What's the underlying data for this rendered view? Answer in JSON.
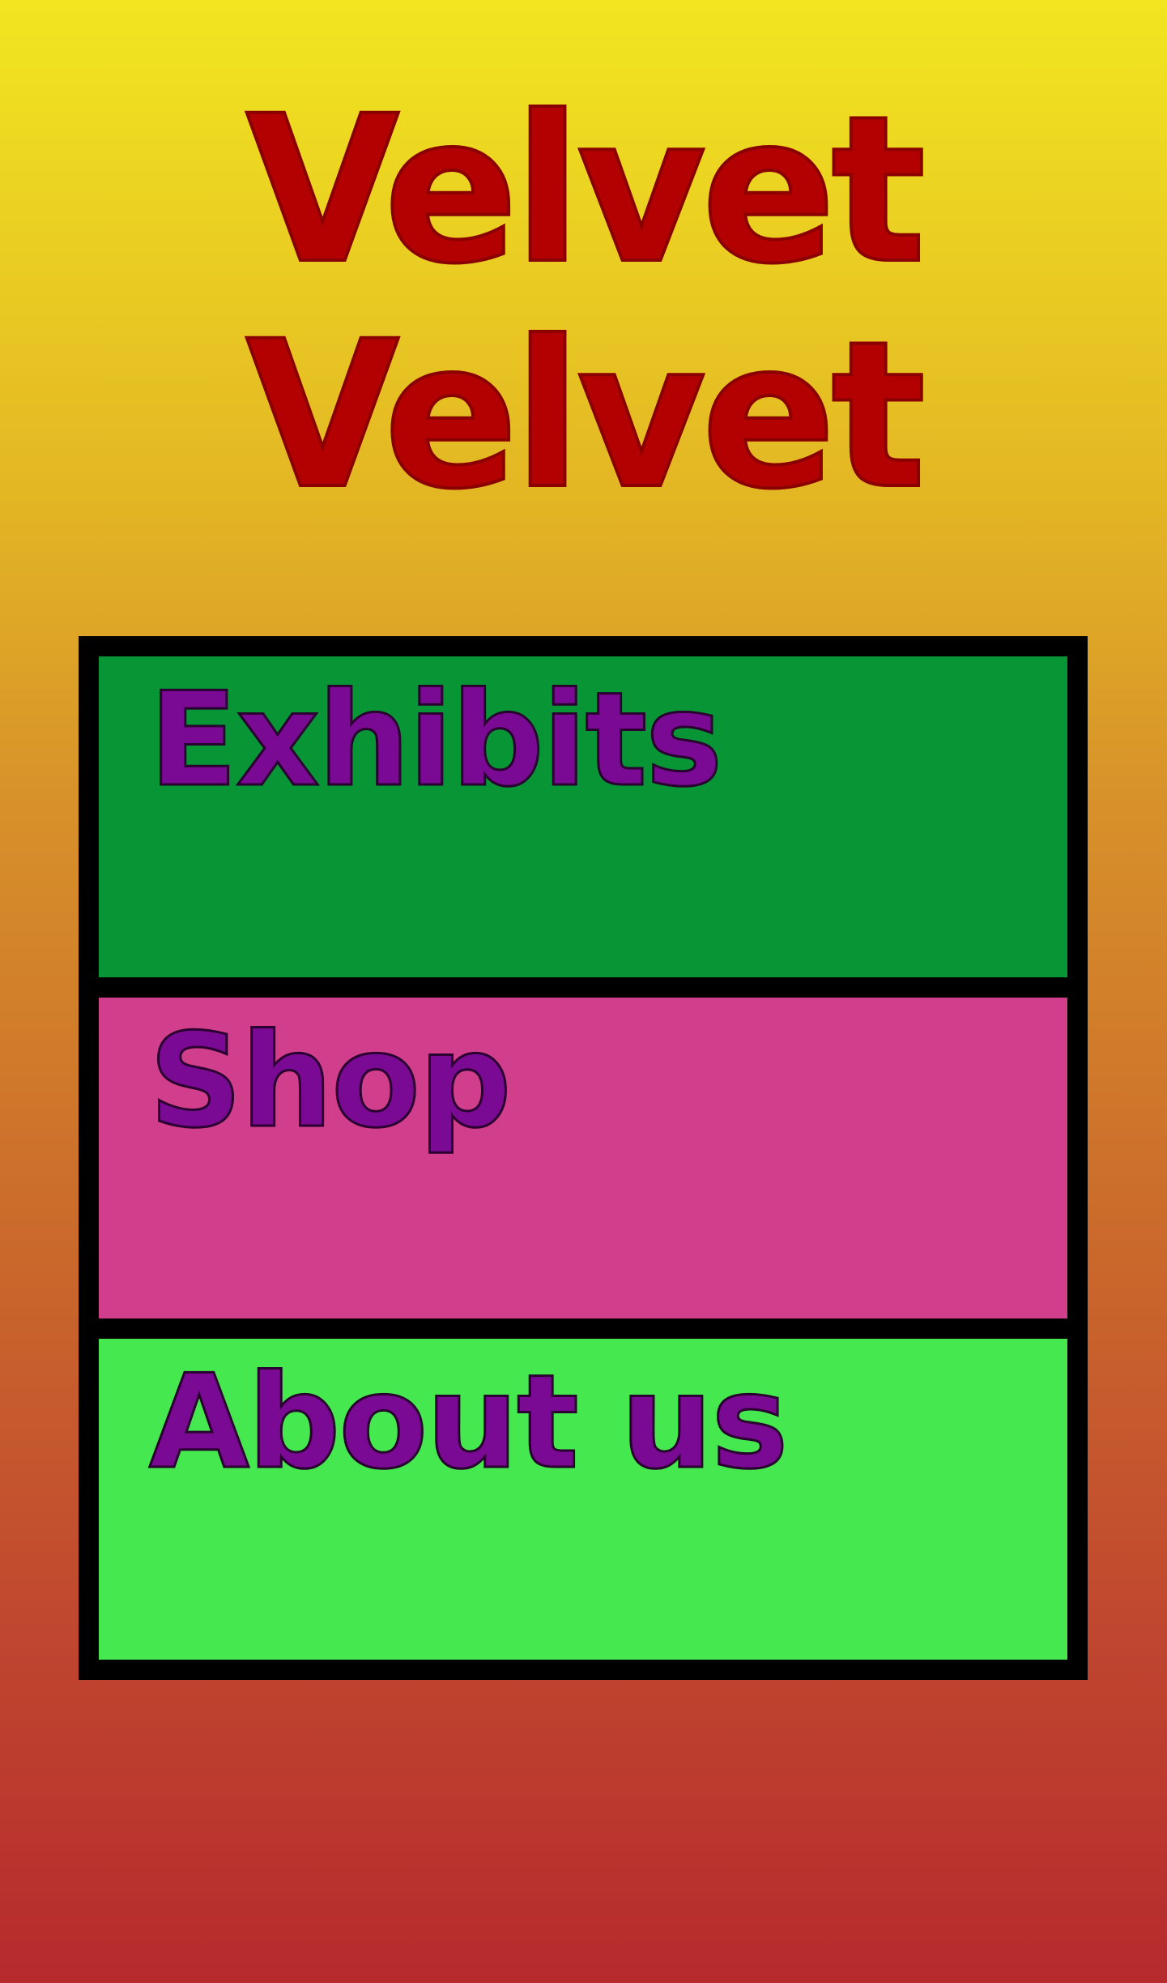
{
  "header": {
    "title_line_1": "Velvet",
    "title_line_2": "Velvet",
    "title_color": "#b30000"
  },
  "menu": {
    "items": [
      {
        "label": "Exhibits",
        "background": "#079536"
      },
      {
        "label": "Shop",
        "background": "#d13e8b"
      },
      {
        "label": "About us",
        "background": "#45e84f"
      }
    ],
    "label_color": "#7a0a93",
    "border_color": "#000000"
  },
  "colors": {
    "background_top": "#f1e620",
    "background_bottom": "#b62a2d"
  }
}
